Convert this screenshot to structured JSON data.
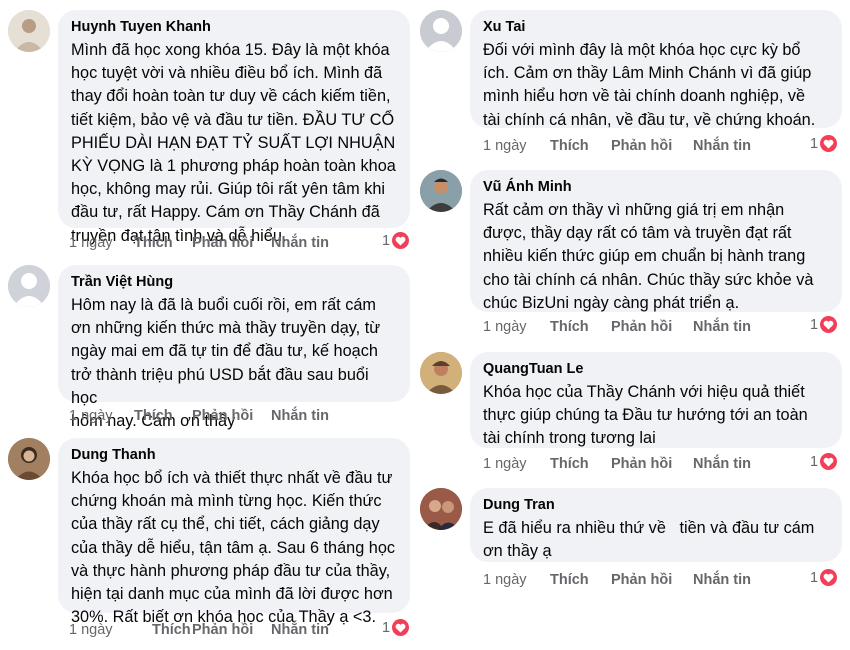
{
  "action_labels": {
    "like": "Thích",
    "reply": "Phản hồi",
    "message": "Nhắn tin"
  },
  "colors": {
    "bubble": "#f0f2f5",
    "meta": "#65676b",
    "heart": "#f33e58"
  },
  "comments": [
    {
      "name": "Huynh Tuyen Khanh",
      "text": "Mình đã học xong khóa 15. Đây là một khóa\nhọc tuyệt vời và nhiều điều bổ ích. Mình đã\nthay đổi hoàn toàn tư duy về cách kiếm tiền,\ntiết kiệm, bảo vệ và đầu tư tiền. ĐẦU TƯ CỔ\nPHIẾU DÀI HẠN ĐẠT TỶ SUẤT LỢI NHUẬN\nKỲ VỌNG là 1 phương pháp hoàn toàn khoa\nhọc, không may rủi. Giúp tôi rất yên tâm khi\nđầu tư, rất Happy. Cám ơn Thầy Chánh đã\ntruyền đạt tận tình và dễ hiểu.",
      "time": "1 ngày",
      "reaction_count": "1",
      "reaction_icon": "heart-icon"
    },
    {
      "name": "Trần Việt Hùng",
      "text": "Hôm nay là đã là buổi cuối rồi, em rất cám\nơn những kiến thức mà thầy truyền dạy, từ\nngày mai em đã tự tin để đầu tư, kế hoạch\ntrở thành triệu phú USD bắt đầu sau buổi học\nhôm nay. Cám ơn thầy",
      "time": "1 ngày",
      "reaction_count": "1",
      "reaction_icon": "heart-icon"
    },
    {
      "name": "Dung Thanh",
      "text": "Khóa học bổ ích và thiết thực nhất về đầu tư\nchứng khoán mà mình từng học. Kiến thức\ncủa thầy rất cụ thể, chi tiết, cách giảng dạy\ncủa thầy dễ hiểu, tận tâm ạ. Sau 6 tháng học\nvà thực hành phương pháp đầu tư của thầy,\nhiện tại danh mục của mình đã lời được hơn\n30%. Rất biết ơn khóa học của Thầy ạ <3.",
      "time": "1 ngày",
      "reaction_count": "1",
      "reaction_icon": "heart-icon"
    },
    {
      "name": "Xu Tai",
      "text": "Đối với mình đây là một khóa học cực kỳ bổ\ních. Cảm ơn thầy Lâm Minh Chánh vì đã giúp\nmình hiểu hơn về tài chính doanh nghiệp, về\ntài chính cá nhân, về đầu tư, về chứng khoán.",
      "time": "1 ngày",
      "reaction_count": "1",
      "reaction_icon": "heart-icon"
    },
    {
      "name": "Vũ Ánh Minh",
      "text": "Rất cảm ơn thầy vì những giá trị em nhận\nđược, thầy dạy rất có tâm và truyền đạt rất\nnhiều kiến thức giúp em chuẩn bị hành trang\ncho tài chính cá nhân. Chúc thầy sức khỏe và\nchúc BizUni ngày càng phát triển ạ.",
      "time": "1 ngày",
      "reaction_count": "1",
      "reaction_icon": "heart-icon"
    },
    {
      "name": "QuangTuan Le",
      "text": "Khóa học của Thầy Chánh với hiệu quả thiết\nthực giúp chúng ta Đầu tư hướng tới an toàn\ntài chính trong tương lai",
      "time": "1 ngày",
      "reaction_count": "1",
      "reaction_icon": "heart-icon"
    },
    {
      "name": "Dung Tran",
      "text": "E đã hiểu ra nhiều thứ về   tiền và đầu tư cám\nơn thầy ạ",
      "time": "1 ngày",
      "reaction_count": "1",
      "reaction_icon": "heart-icon"
    }
  ]
}
